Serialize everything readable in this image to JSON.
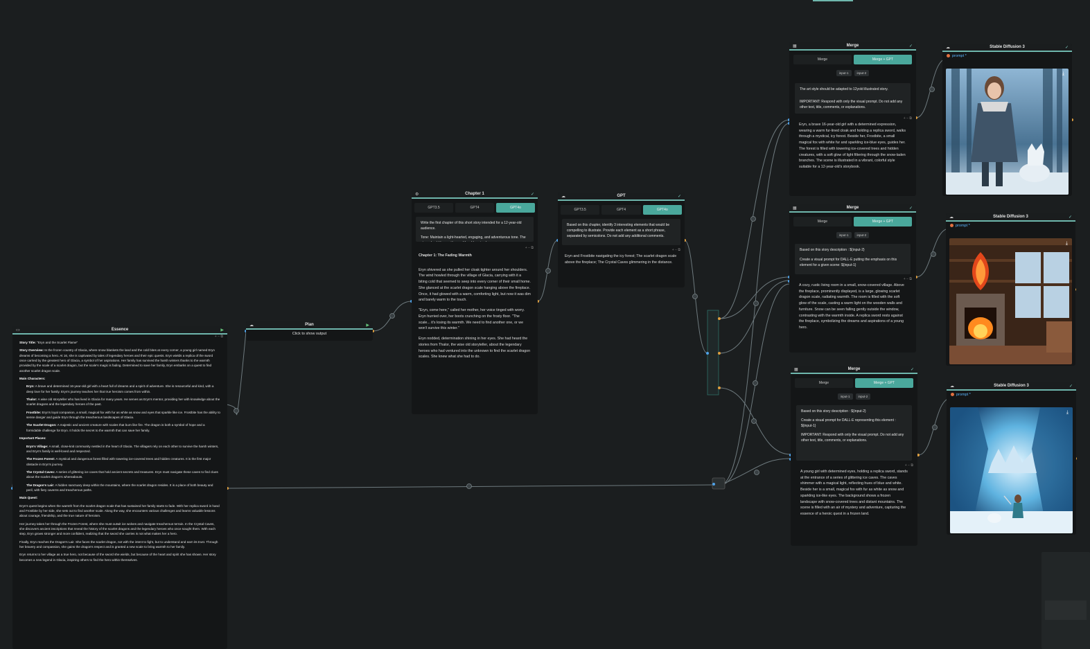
{
  "essence": {
    "title": "Essence",
    "story_title_label": "Story Title:",
    "story_title": "\"Eryn and the Scarlet Flame\"",
    "overview_label": "Story Overview:",
    "overview": "In the frozen country of Glacia, where snow blankets the land and the cold bites at every corner, a young girl named Eryn dreams of becoming a hero. At 16, she is captivated by tales of legendary heroes and their epic quests. Eryn wields a replica of the sword once carried by the greatest hero of Glacia, a symbol of her aspirations. Her family has survived the harsh winters thanks to the warmth provided by the scale of a scarlet dragon, but the scale's magic is fading. Determined to save her family, Eryn embarks on a quest to find another scarlet dragon scale.",
    "main_characters_label": "Main Characters:",
    "characters": [
      {
        "name": "Eryn:",
        "text": "A brave and determined 16-year-old girl with a heart full of dreams and a spirit of adventure. She is resourceful and kind, with a deep love for her family. Eryn's journey teaches her that true heroism comes from within."
      },
      {
        "name": "Thalor:",
        "text": "A wise old storyteller who has lived in Glacia for many years. He serves as Eryn's mentor, providing her with knowledge about the scarlet dragons and the legendary heroes of the past."
      },
      {
        "name": "Frostbite:",
        "text": "Eryn's loyal companion, a small, magical fox with fur as white as snow and eyes that sparkle like ice. Frostbite has the ability to sense danger and guide Eryn through the treacherous landscapes of Glacia."
      },
      {
        "name": "The Scarlet Dragon:",
        "text": "A majestic and ancient creature with scales that burn like fire. The dragon is both a symbol of hope and a formidable challenge for Eryn. It holds the secret to the warmth that can save her family."
      }
    ],
    "places_label": "Important Places:",
    "places": [
      {
        "name": "Eryn's Village:",
        "text": "A small, close-knit community nestled in the heart of Glacia. The villagers rely on each other to survive the harsh winters, and Eryn's family is well-loved and respected."
      },
      {
        "name": "The Frozen Forest:",
        "text": "A mystical and dangerous forest filled with towering ice-covered trees and hidden creatures. It is the first major obstacle in Eryn's journey."
      },
      {
        "name": "The Crystal Caves:",
        "text": "A series of glittering ice caves that hold ancient secrets and treasures. Eryn must navigate these caves to find clues about the scarlet dragon's whereabouts."
      },
      {
        "name": "The Dragon's Lair:",
        "text": "A hidden sanctuary deep within the mountains, where the scarlet dragon resides. It is a place of both beauty and peril, with fiery caverns and treacherous paths."
      }
    ],
    "quest_label": "Main Quest:",
    "quest": [
      "Eryn's quest begins when the warmth from the scarlet dragon scale that has sustained her family starts to fade. With her replica sword in hand and Frostbite by her side, she sets out to find another scale. Along the way, she encounters various challenges and learns valuable lessons about courage, friendship, and the true nature of heroism.",
      "Her journey takes her through the Frozen Forest, where she must outwit ice wolves and navigate treacherous terrain. In the Crystal Caves, she discovers ancient inscriptions that reveal the history of the scarlet dragons and the legendary heroes who once sought them. With each step, Eryn grows stronger and more confident, realizing that the sword she carries is not what makes her a hero.",
      "Finally, Eryn reaches the Dragon's Lair. She faces the scarlet dragon, not with the intent to fight, but to understand and earn its trust. Through her bravery and compassion, she gains the dragon's respect and is granted a new scale to bring warmth to her family.",
      "Eryn returns to her village as a true hero, not because of the sword she wields, but because of the heart and spirit she has shown. Her story becomes a new legend in Glacia, inspiring others to find the hero within themselves."
    ]
  },
  "plan": {
    "title": "Plan",
    "output": "Click to show output"
  },
  "chapter": {
    "title": "Chapter 1",
    "tabs": [
      "GPT3.5",
      "GPT4",
      "GPT4o"
    ],
    "prompt": [
      "Write the first chapter of this short story intended for a 12-year-old audience.",
      "Tone: Maintain a light-hearted, engaging, and adventurous tone. The story should be positive and fun. Use simple"
    ],
    "out_title": "Chapter 1: The Fading Warmth",
    "out": [
      "Eryn shivered as she pulled her cloak tighter around her shoulders. The wind howled through the village of Glacia, carrying with it a biting cold that seemed to seep into every corner of their small home. She glanced at the scarlet dragon scale hanging above the fireplace. Once, it had glowed with a warm, comforting light, but now it was dim and barely warm to the touch.",
      "\"Eryn, come here,\" called her mother, her voice tinged with worry. Eryn hurried over, her boots crunching on the frosty floor. \"The scale... it's losing its warmth. We need to find another one, or we won't survive this winter.\"",
      "Eryn nodded, determination shining in her eyes. She had heard the stories from Thalor, the wise old storyteller, about the legendary heroes who had ventured into the unknown to find the scarlet dragon scales. She knew what she had to do."
    ]
  },
  "gpt": {
    "title": "GPT",
    "tabs": [
      "GPT3.5",
      "GPT4",
      "GPT4o"
    ],
    "prompt": "Based on this chapter, identify 3 interesting elements that would be compelling to illustrate. Provide each element as a short phrase, separated by semicolons. Do not add any additional comments.",
    "out": "Eryn and Frostbite navigating the icy forest; The scarlet dragon scale above the fireplace; The Crystal Caves glimmering in the distance."
  },
  "merges": [
    {
      "title": "Merge",
      "tabs": [
        "Merge",
        "Merge + GPT"
      ],
      "inputs": [
        "input-1",
        "input-2"
      ],
      "prompt": [
        "The art style should be adapted to 12yold illustrated story.",
        "IMPORTANT: Respond with only the visual prompt. Do not add any other text, title, comments, or explanations."
      ],
      "out": "Eryn, a brave 16-year-old girl with a determined expression, wearing a warm fur-lined cloak and holding a replica sword, walks through a mystical, icy forest. Beside her, Frostbite, a small magical fox with white fur and sparkling ice-blue eyes, guides her. The forest is filled with towering ice-covered trees and hidden creatures, with a soft glow of light filtering through the snow-laden branches. The scene is illustrated in a vibrant, colorful style suitable for a 12-year-old's storybook."
    },
    {
      "title": "Merge",
      "tabs": [
        "Merge",
        "Merge + GPT"
      ],
      "inputs": [
        "input-1",
        "input-2"
      ],
      "prompt": [
        "Based on this story description : ${input-2}",
        "Create a visual prompt for DALL-E putting the emphasis on this element for a given scene: ${input-1}"
      ],
      "out": "A cozy, rustic living room in a small, snow-covered village. Above the fireplace, prominently displayed, is a large, glowing scarlet dragon scale, radiating warmth. The room is filled with the soft glow of the scale, casting a warm light on the wooden walls and furniture. Snow can be seen falling gently outside the window, contrasting with the warmth inside. A replica sword rests against the fireplace, symbolizing the dreams and aspirations of a young hero."
    },
    {
      "title": "Merge",
      "tabs": [
        "Merge",
        "Merge + GPT"
      ],
      "inputs": [
        "input-1",
        "input-2"
      ],
      "prompt": [
        "Based on this story description : ${input-2}",
        "Create a visual prompt for DALL-E representing this element : ${input-1}",
        "IMPORTANT: Respond with only the visual prompt. Do not add any other text, title, comments, or explanations."
      ],
      "out": "A young girl with determined eyes, holding a replica sword, stands at the entrance of a series of glittering ice caves. The caves shimmer with a magical light, reflecting hues of blue and white. Beside her is a small, magical fox with fur as white as snow and sparkling ice-like eyes. The background shows a frozen landscape with snow-covered trees and distant mountains. The scene is filled with an air of mystery and adventure, capturing the essence of a heroic quest in a frozen land."
    }
  ],
  "sd": {
    "title": "Stable Diffusion 3",
    "prompt_label": "prompt",
    "prompt_star": "*"
  },
  "icons": {
    "ok": "✓",
    "run": "▶",
    "ctrl": "+ − ⧉",
    "dl": "⤓",
    "gear": "⚙",
    "grid": "▦",
    "monitor": "▭",
    "cloud": "☁"
  }
}
